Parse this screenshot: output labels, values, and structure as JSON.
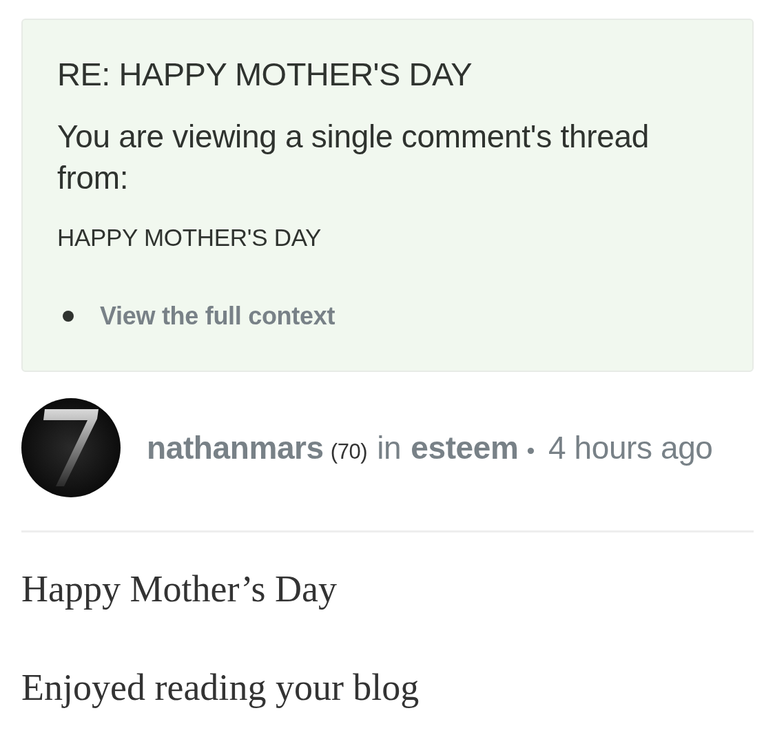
{
  "context_card": {
    "title": "RE: HAPPY MOTHER'S DAY",
    "notice": "You are viewing a single comment's thread from:",
    "parent_title": "HAPPY MOTHER'S DAY",
    "links": [
      "View the full context"
    ]
  },
  "comment": {
    "author": "nathanmars",
    "reputation": "(70)",
    "preposition": "in",
    "community": "esteem",
    "separator": "•",
    "time": "4 hours ago",
    "body": [
      "Happy Mother’s Day",
      "Enjoyed reading your blog"
    ]
  }
}
